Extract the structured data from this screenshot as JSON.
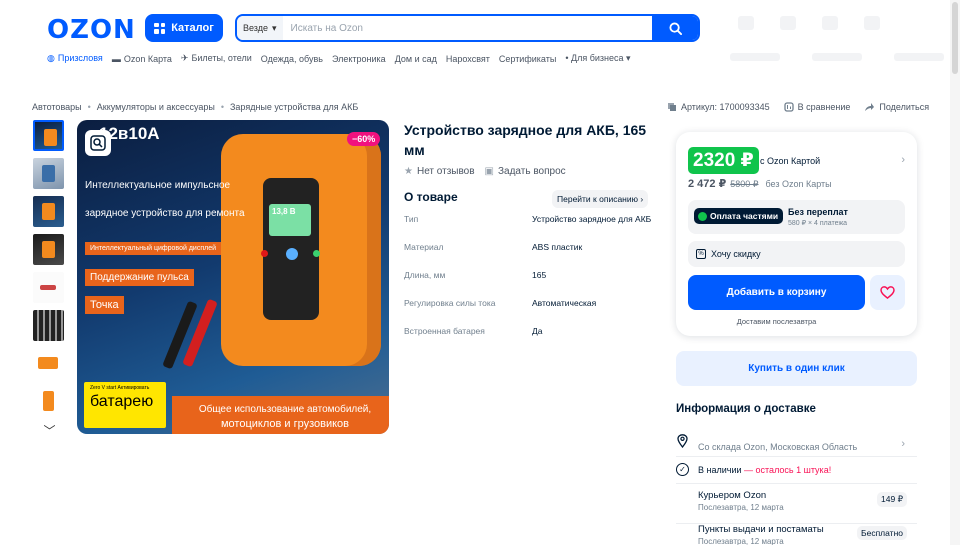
{
  "header": {
    "logo": "OZON",
    "catalog_label": "Каталог",
    "search_scope": "Везде",
    "search_placeholder": "Искать на Ozon"
  },
  "subnav": {
    "items": [
      "Призсловя",
      "Ozon Карта",
      "Билеты, отели",
      "Одежда, обувь",
      "Электроника",
      "Дом и сад",
      "Нарохсвят",
      "Сертификаты",
      "Для бизнеса"
    ]
  },
  "breadcrumb": [
    "Автотовары",
    "Аккумуляторы и аксессуары",
    "Зарядные устройства для АКБ"
  ],
  "meta": {
    "article": "Артикул: 1700093345",
    "compare": "В сравнение",
    "share": "Поделиться"
  },
  "gallery": {
    "voltage_text": "12в10А",
    "discount": "−60%",
    "headline_1": "Интеллектуальное импульсное",
    "headline_2": "зарядное устройство для ремонта",
    "tag_1": "Интеллектуальный цифровой дисплей",
    "tag_2": "Поддержание пульса",
    "tag_3": "Точка",
    "screen_value": "13,8 В",
    "badge_small": "Zero V start Активировать",
    "badge_big": "батарею",
    "bottom_1": "Общее использование автомобилей,",
    "bottom_2": "мотоциклов и грузовиков"
  },
  "product": {
    "title": "Устройство зарядное для АКБ, 165 мм",
    "reviews": "Нет отзывов",
    "ask": "Задать вопрос",
    "about_heading": "О товаре",
    "goto_description": "Перейти к описанию",
    "specs": [
      {
        "key": "Тип",
        "value": "Устройство зарядное для АКБ"
      },
      {
        "key": "Материал",
        "value": "ABS пластик"
      },
      {
        "key": "Длина, мм",
        "value": "165"
      },
      {
        "key": "Регулировка силы тока",
        "value": "Автоматическая"
      },
      {
        "key": "Встроенная батарея",
        "value": "Да"
      }
    ]
  },
  "pricing": {
    "ozon_card_price": "2320 ₽",
    "ozon_card_label": "с Ozon Картой",
    "regular_price": "2 472 ₽",
    "old_price": "5800 ₽",
    "regular_label": "без Ozon Карты",
    "split_badge": "Оплата частями",
    "split_title": "Без переплат",
    "split_detail": "580 ₽ × 4 платежа",
    "discount_request": "Хочу скидку",
    "add_to_cart": "Добавить в корзину",
    "delivery_note": "Доставим послезавтра",
    "buy_one_click": "Купить в один клик"
  },
  "delivery": {
    "heading": "Информация о доставке",
    "location": "Со склада Ozon, Московская Область",
    "stock_prefix": "В наличии",
    "stock_warning": "— осталось 1 штука!",
    "options": [
      {
        "name": "Курьером Ozon",
        "date": "Послезавтра, 12 марта",
        "price": "149 ₽"
      },
      {
        "name": "Пункты выдачи и постаматы",
        "date": "Послезавтра, 12 марта",
        "price": "Бесплатно"
      }
    ]
  },
  "colors": {
    "brand_blue": "#005bff",
    "ozon_card_green": "#10c44c",
    "discount_pink": "#f1117e",
    "warning_red": "#f91155"
  }
}
